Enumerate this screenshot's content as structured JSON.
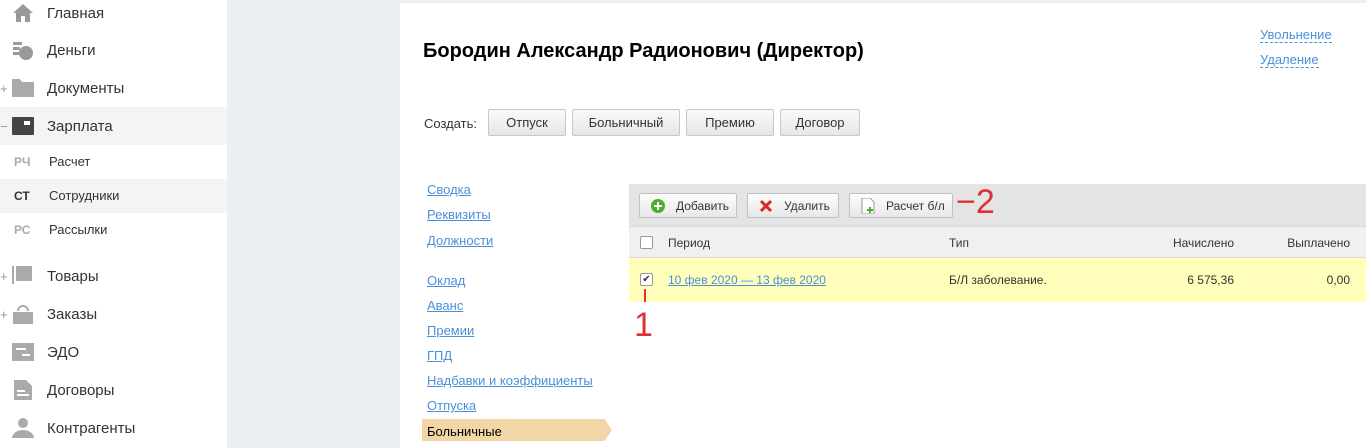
{
  "sidebar": {
    "items": [
      {
        "label": "Главная",
        "icon": "home-icon"
      },
      {
        "label": "Деньги",
        "icon": "money-icon"
      },
      {
        "label": "Документы",
        "icon": "folder-icon",
        "expander": "+"
      },
      {
        "label": "Зарплата",
        "icon": "wallet-icon",
        "expander": "−"
      },
      {
        "label": "Товары",
        "icon": "goods-icon",
        "expander": "+"
      },
      {
        "label": "Заказы",
        "icon": "basket-icon",
        "expander": "+"
      },
      {
        "label": "ЭДО",
        "icon": "edo-icon"
      },
      {
        "label": "Договоры",
        "icon": "contract-icon"
      },
      {
        "label": "Контрагенты",
        "icon": "contractor-icon"
      }
    ],
    "subitems": [
      {
        "abbr": "РЧ",
        "label": "Расчет"
      },
      {
        "abbr": "СТ",
        "label": "Сотрудники"
      },
      {
        "abbr": "РС",
        "label": "Рассылки"
      }
    ]
  },
  "header": {
    "title": "Бородин Александр Радионович (Директор)",
    "links": [
      "Увольнение",
      "Удаление"
    ]
  },
  "create": {
    "label": "Создать:",
    "buttons": [
      "Отпуск",
      "Больничный",
      "Премию",
      "Договор"
    ]
  },
  "tabs": [
    "Сводка",
    "Реквизиты",
    "Должности",
    "Оклад",
    "Аванс",
    "Премии",
    "ГПД",
    "Надбавки и коэффициенты",
    "Отпуска",
    "Больничные"
  ],
  "toolbar": {
    "add": "Добавить",
    "delete": "Удалить",
    "calc": "Расчет б/л"
  },
  "table": {
    "columns": [
      "Период",
      "Тип",
      "Начислено",
      "Выплачено"
    ],
    "rows": [
      {
        "period": "10 фев 2020 — 13 фев 2020",
        "type": "Б/Л заболевание.",
        "accrued": "6 575,36",
        "paid": "0,00",
        "checked": true
      }
    ]
  },
  "annotations": [
    "1",
    "2"
  ],
  "colors": {
    "link": "#4a90d9",
    "selected_row": "#ffffbb",
    "active_tab": "#f2d6a6",
    "annotation": "#e03030"
  }
}
